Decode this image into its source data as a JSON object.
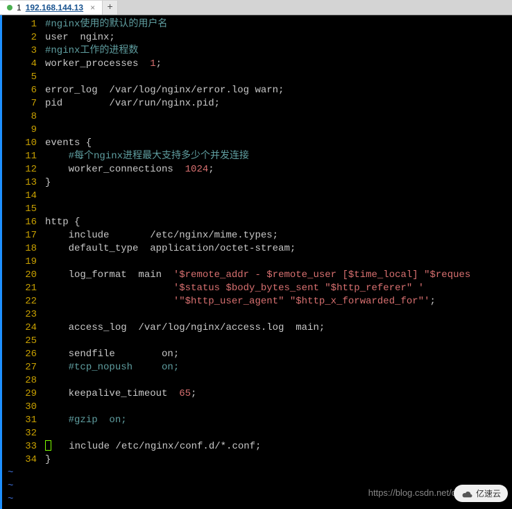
{
  "tab": {
    "index": "1",
    "title": "192.168.144.13",
    "close": "×",
    "add": "+"
  },
  "lines": [
    {
      "n": "1",
      "c": "<span class='c-comment'>#nginx使用的默认的用户名</span>"
    },
    {
      "n": "2",
      "c": "user  nginx;"
    },
    {
      "n": "3",
      "c": "<span class='c-comment'>#nginx工作的进程数</span>"
    },
    {
      "n": "4",
      "c": "worker_processes  <span class='c-number'>1</span>;"
    },
    {
      "n": "5",
      "c": ""
    },
    {
      "n": "6",
      "c": "error_log  /var/log/nginx/error.log warn;"
    },
    {
      "n": "7",
      "c": "pid        /var/run/nginx.pid;"
    },
    {
      "n": "8",
      "c": ""
    },
    {
      "n": "9",
      "c": ""
    },
    {
      "n": "10",
      "c": "events {"
    },
    {
      "n": "11",
      "c": "    <span class='c-comment'>#每个nginx进程最大支持多少个并发连接</span>"
    },
    {
      "n": "12",
      "c": "    worker_connections  <span class='c-number'>1024</span>;"
    },
    {
      "n": "13",
      "c": "}"
    },
    {
      "n": "14",
      "c": ""
    },
    {
      "n": "15",
      "c": ""
    },
    {
      "n": "16",
      "c": "http {"
    },
    {
      "n": "17",
      "c": "    include       /etc/nginx/mime.types;"
    },
    {
      "n": "18",
      "c": "    default_type  application/octet-stream;"
    },
    {
      "n": "19",
      "c": ""
    },
    {
      "n": "20",
      "c": "    log_format  main  <span class='c-string'>'$remote_addr - $remote_user [$time_local] \"$reques</span>"
    },
    {
      "n": "21",
      "c": "                      <span class='c-string'>'$status $body_bytes_sent \"$http_referer\" '</span>"
    },
    {
      "n": "22",
      "c": "                      <span class='c-string'>'\"$http_user_agent\" \"$http_x_forwarded_for\"'</span>;"
    },
    {
      "n": "23",
      "c": ""
    },
    {
      "n": "24",
      "c": "    access_log  /var/log/nginx/access.log  main;"
    },
    {
      "n": "25",
      "c": ""
    },
    {
      "n": "26",
      "c": "    sendfile        on;"
    },
    {
      "n": "27",
      "c": "    <span class='c-comment'>#tcp_nopush     on;</span>"
    },
    {
      "n": "28",
      "c": ""
    },
    {
      "n": "29",
      "c": "    keepalive_timeout  <span class='c-number'>65</span>;"
    },
    {
      "n": "30",
      "c": ""
    },
    {
      "n": "31",
      "c": "    <span class='c-comment'>#gzip  on;</span>"
    },
    {
      "n": "32",
      "c": ""
    },
    {
      "n": "33",
      "c": "<span class='cursor-box'></span>   include /etc/nginx/conf.d/*.conf;"
    },
    {
      "n": "34",
      "c": "}"
    }
  ],
  "tildes": [
    "~",
    "~",
    "~"
  ],
  "watermark": "https://blog.csdn.net/q",
  "logo_text": "亿速云"
}
